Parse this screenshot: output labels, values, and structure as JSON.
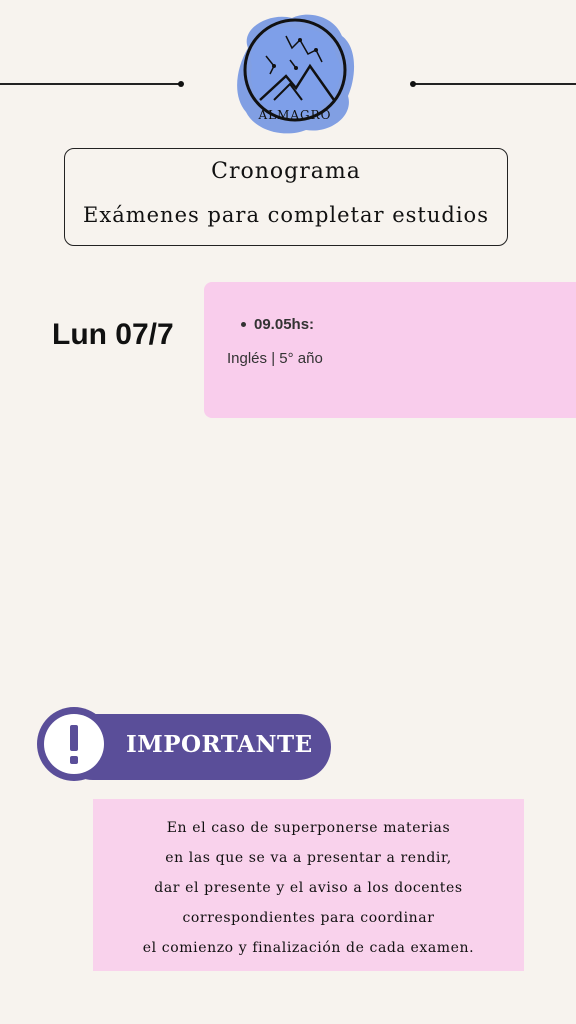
{
  "header": {
    "logo_text": "ALMAGRO"
  },
  "title": {
    "line1": "Cronograma",
    "line2": "Exámenes para completar estudios"
  },
  "schedule": [
    {
      "date": "Lun 07/7",
      "time": "09.05hs:",
      "subject": "Inglés | 5° año"
    }
  ],
  "important": {
    "label": "IMPORTANTE",
    "note_lines": [
      "En el caso de superponerse materias",
      "en las que se va a presentar a rendir,",
      "dar el presente y el aviso a los docentes",
      "correspondientes para coordinar",
      "el comienzo y finalización de cada examen."
    ]
  },
  "colors": {
    "background": "#f7f3ee",
    "card_pink": "#f9cdec",
    "note_pink": "#f9d2ec",
    "accent_purple": "#5a4e99",
    "logo_blue": "#6c8fe0"
  }
}
